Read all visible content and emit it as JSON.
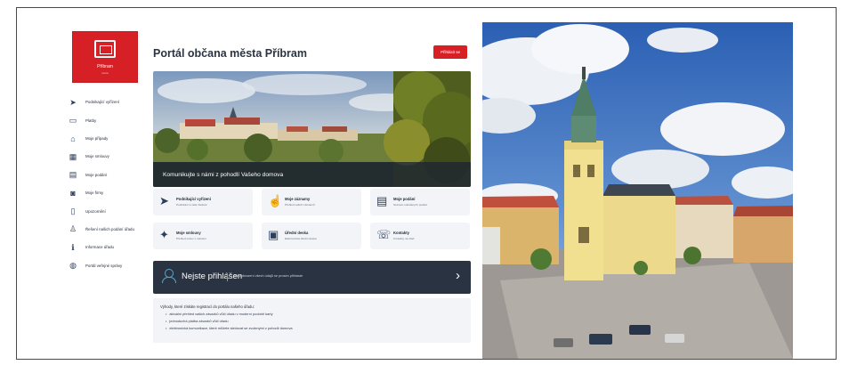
{
  "logo": {
    "city": "Příbram",
    "subtitle": "město"
  },
  "sidebar": {
    "items": [
      {
        "label": "Podnikající vyřízení",
        "icon": "paper-plane-icon",
        "glyph": "➤"
      },
      {
        "label": "Platby",
        "icon": "wallet-icon",
        "glyph": "▭"
      },
      {
        "label": "Moje případy",
        "icon": "house-icon",
        "glyph": "⌂"
      },
      {
        "label": "Moje smlouvy",
        "icon": "calendar-icon",
        "glyph": "▦"
      },
      {
        "label": "Moje podání",
        "icon": "document-icon",
        "glyph": "▤"
      },
      {
        "label": "Moje firmy",
        "icon": "car-icon",
        "glyph": "◙"
      },
      {
        "label": "Upozornění",
        "icon": "phone-icon",
        "glyph": "▯"
      },
      {
        "label": "Řešení našich podání úřadu",
        "icon": "person-icon",
        "glyph": "♙"
      },
      {
        "label": "Informace úřadu",
        "icon": "info-icon",
        "glyph": "ℹ"
      },
      {
        "label": "Portál veřejné správy",
        "icon": "globe-icon",
        "glyph": "◍"
      }
    ]
  },
  "header": {
    "title": "Portál občana města Příbram",
    "signin_label": "Přihlásit se"
  },
  "hero": {
    "caption": "Komunikujte s námi z pohodlí Vašeho domova"
  },
  "quick_links": [
    {
      "title": "Podnikající vyřízení",
      "subtitle": "Podnikání a vaše žádosti",
      "icon": "paper-plane-icon",
      "glyph": "➤"
    },
    {
      "title": "Moje záznamy",
      "subtitle": "Přehled vašich záznamů",
      "icon": "hand-icon",
      "glyph": "☝"
    },
    {
      "title": "Moje podání",
      "subtitle": "Seznam odeslaných podání",
      "icon": "document-icon",
      "glyph": "▤"
    },
    {
      "title": "Moje smlouvy",
      "subtitle": "Přehled smluv s městem",
      "icon": "handshake-icon",
      "glyph": "✦"
    },
    {
      "title": "Úřední deska",
      "subtitle": "Elektronická úřední deska",
      "icon": "board-icon",
      "glyph": "▣"
    },
    {
      "title": "Kontakty",
      "subtitle": "Kontakty na úřad",
      "icon": "contacts-icon",
      "glyph": "☏"
    }
  ],
  "login_bar": {
    "title": "Nejste přihlášen",
    "subtitle": "Pro zobrazení všech údajů se prosím přihlaste"
  },
  "benefits": {
    "heading": "Výhody, které získáte registrací do portálu našeho úřadu:",
    "items": [
      "aktuální přehled vašich závazků vůči úřadu v moderní podobě karty",
      "jednoduchá platba závazků vůči úřadu",
      "elektronická komunikace, které můžete sledovat se zvolenými z pohodlí domova"
    ]
  },
  "colors": {
    "brand_red": "#d71f26",
    "dark_navy": "#2a3342",
    "card_bg": "#f2f4f7"
  }
}
